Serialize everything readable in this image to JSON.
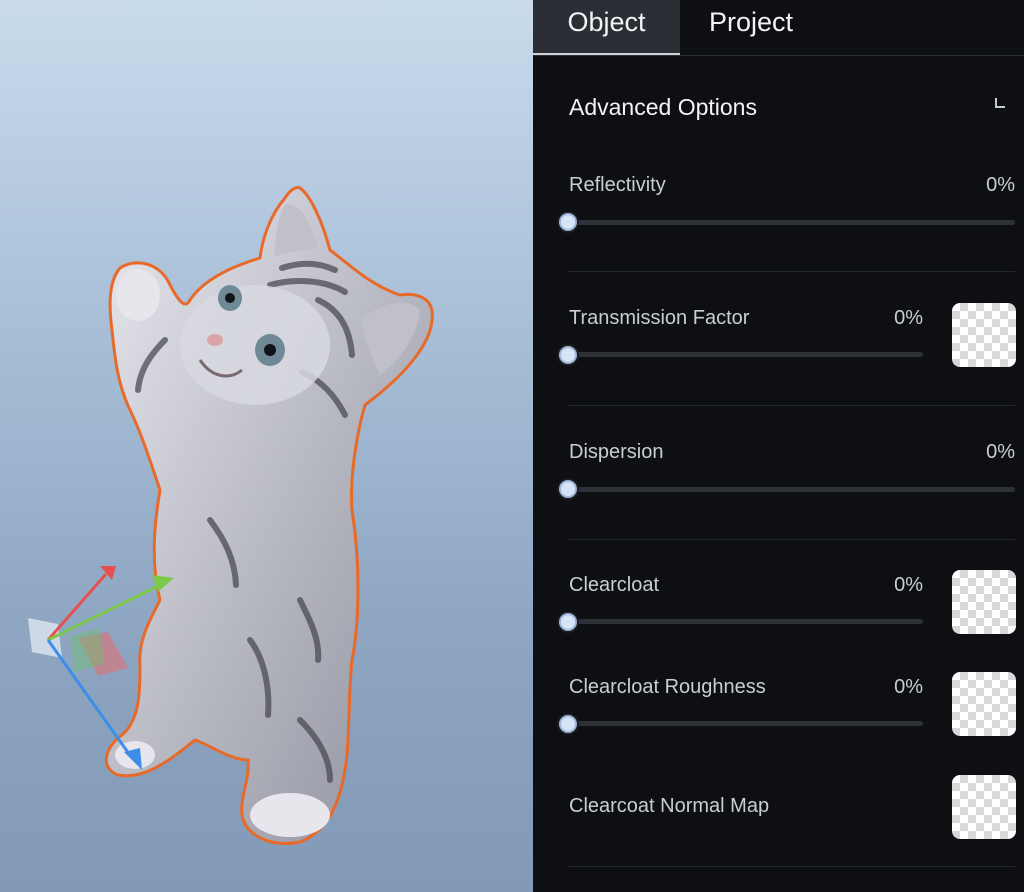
{
  "tabs": {
    "object": "Object",
    "project": "Project"
  },
  "section": {
    "title": "Advanced Options"
  },
  "properties": [
    {
      "label": "Reflectivity",
      "value": "0%"
    },
    {
      "label": "Transmission Factor",
      "value": "0%"
    },
    {
      "label": "Dispersion",
      "value": "0%"
    },
    {
      "label": "Clearcloat",
      "value": "0%"
    },
    {
      "label": "Clearcloat Roughness",
      "value": "0%"
    },
    {
      "label": "Clearcoat Normal Map"
    }
  ],
  "colors": {
    "panel_bg": "#0e0f12",
    "selection_outline": "#e86a2a",
    "gizmo_x": "#e55050",
    "gizmo_y": "#7cc94a",
    "gizmo_z": "#3d8ee8"
  }
}
